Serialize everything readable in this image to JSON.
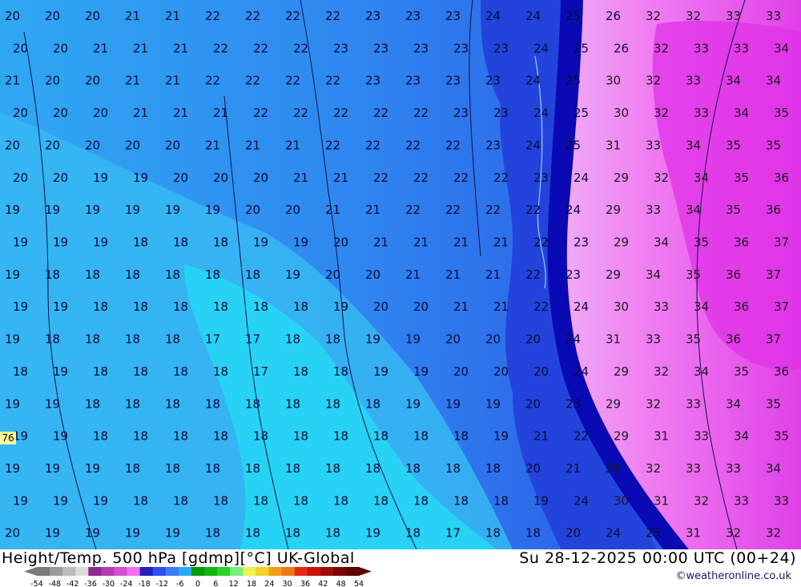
{
  "header": {
    "title": "Height/Temp. 500 hPa [gdmp][°C] UK-Global",
    "datetime": "Su 28-12-2025 00:00 UTC (00+24)",
    "credit": "©weatheronline.co.uk"
  },
  "edge_label": "76",
  "scale": {
    "labels": [
      "-54",
      "-48",
      "-42",
      "-36",
      "-30",
      "-24",
      "-18",
      "-12",
      "-6",
      "0",
      "6",
      "12",
      "18",
      "24",
      "30",
      "36",
      "42",
      "48",
      "54"
    ],
    "colors": [
      "#7a7a7a",
      "#9a9a9a",
      "#bcbcbc",
      "#dcdcdc",
      "#8c2a8c",
      "#b03cb0",
      "#d24fd2",
      "#f070f0",
      "#2020b8",
      "#2850f0",
      "#3c7cf5",
      "#28aaf5",
      "#0a9a0a",
      "#14b414",
      "#28d228",
      "#78f078",
      "#f0f050",
      "#f0d228",
      "#f0a014",
      "#f07814",
      "#e62814",
      "#c8140a",
      "#a00a0a",
      "#7a0505",
      "#5a0000"
    ]
  },
  "map_data": {
    "value_grid": [
      [
        "20",
        "20",
        "20",
        "21",
        "21",
        "22",
        "22",
        "22",
        "22",
        "23",
        "23",
        "23",
        "24",
        "24",
        "25",
        "26",
        "32",
        "32",
        "33",
        "33"
      ],
      [
        "20",
        "20",
        "21",
        "21",
        "21",
        "22",
        "22",
        "22",
        "23",
        "23",
        "23",
        "23",
        "23",
        "24",
        "25",
        "26",
        "32",
        "33",
        "33",
        "34"
      ],
      [
        "21",
        "20",
        "20",
        "21",
        "21",
        "22",
        "22",
        "22",
        "22",
        "23",
        "23",
        "23",
        "23",
        "24",
        "25",
        "30",
        "32",
        "33",
        "34",
        "34"
      ],
      [
        "20",
        "20",
        "20",
        "21",
        "21",
        "21",
        "22",
        "22",
        "22",
        "22",
        "22",
        "23",
        "23",
        "24",
        "25",
        "30",
        "32",
        "33",
        "34",
        "35"
      ],
      [
        "20",
        "20",
        "20",
        "20",
        "20",
        "21",
        "21",
        "21",
        "22",
        "22",
        "22",
        "22",
        "23",
        "24",
        "25",
        "31",
        "33",
        "34",
        "35",
        "35"
      ],
      [
        "20",
        "20",
        "19",
        "19",
        "20",
        "20",
        "20",
        "21",
        "21",
        "22",
        "22",
        "22",
        "22",
        "23",
        "24",
        "29",
        "32",
        "34",
        "35",
        "36"
      ],
      [
        "19",
        "19",
        "19",
        "19",
        "19",
        "19",
        "20",
        "20",
        "21",
        "21",
        "22",
        "22",
        "22",
        "22",
        "24",
        "29",
        "33",
        "34",
        "35",
        "36"
      ],
      [
        "19",
        "19",
        "19",
        "18",
        "18",
        "18",
        "19",
        "19",
        "20",
        "21",
        "21",
        "21",
        "21",
        "22",
        "23",
        "29",
        "34",
        "35",
        "36",
        "37"
      ],
      [
        "19",
        "18",
        "18",
        "18",
        "18",
        "18",
        "18",
        "19",
        "20",
        "20",
        "21",
        "21",
        "21",
        "22",
        "23",
        "29",
        "34",
        "35",
        "36",
        "37"
      ],
      [
        "19",
        "19",
        "18",
        "18",
        "18",
        "18",
        "18",
        "18",
        "19",
        "20",
        "20",
        "21",
        "21",
        "22",
        "24",
        "30",
        "33",
        "34",
        "36",
        "37"
      ],
      [
        "19",
        "18",
        "18",
        "18",
        "18",
        "17",
        "17",
        "18",
        "18",
        "19",
        "19",
        "20",
        "20",
        "20",
        "24",
        "31",
        "33",
        "35",
        "36",
        "37"
      ],
      [
        "18",
        "19",
        "18",
        "18",
        "18",
        "18",
        "17",
        "18",
        "18",
        "19",
        "19",
        "20",
        "20",
        "20",
        "24",
        "29",
        "32",
        "34",
        "35",
        "36"
      ],
      [
        "19",
        "19",
        "18",
        "18",
        "18",
        "18",
        "18",
        "18",
        "18",
        "18",
        "19",
        "19",
        "19",
        "20",
        "23",
        "29",
        "32",
        "33",
        "34",
        "35"
      ],
      [
        "19",
        "19",
        "18",
        "18",
        "18",
        "18",
        "18",
        "18",
        "18",
        "18",
        "18",
        "18",
        "19",
        "21",
        "22",
        "29",
        "31",
        "33",
        "34",
        "35"
      ],
      [
        "19",
        "19",
        "19",
        "18",
        "18",
        "18",
        "18",
        "18",
        "18",
        "18",
        "18",
        "18",
        "18",
        "20",
        "21",
        "29",
        "32",
        "33",
        "33",
        "34"
      ],
      [
        "19",
        "19",
        "19",
        "18",
        "18",
        "18",
        "18",
        "18",
        "18",
        "18",
        "18",
        "18",
        "18",
        "19",
        "24",
        "30",
        "31",
        "32",
        "33",
        "33"
      ],
      [
        "20",
        "19",
        "19",
        "19",
        "19",
        "18",
        "18",
        "18",
        "18",
        "19",
        "18",
        "17",
        "18",
        "18",
        "20",
        "24",
        "25",
        "31",
        "32",
        "32"
      ]
    ]
  }
}
